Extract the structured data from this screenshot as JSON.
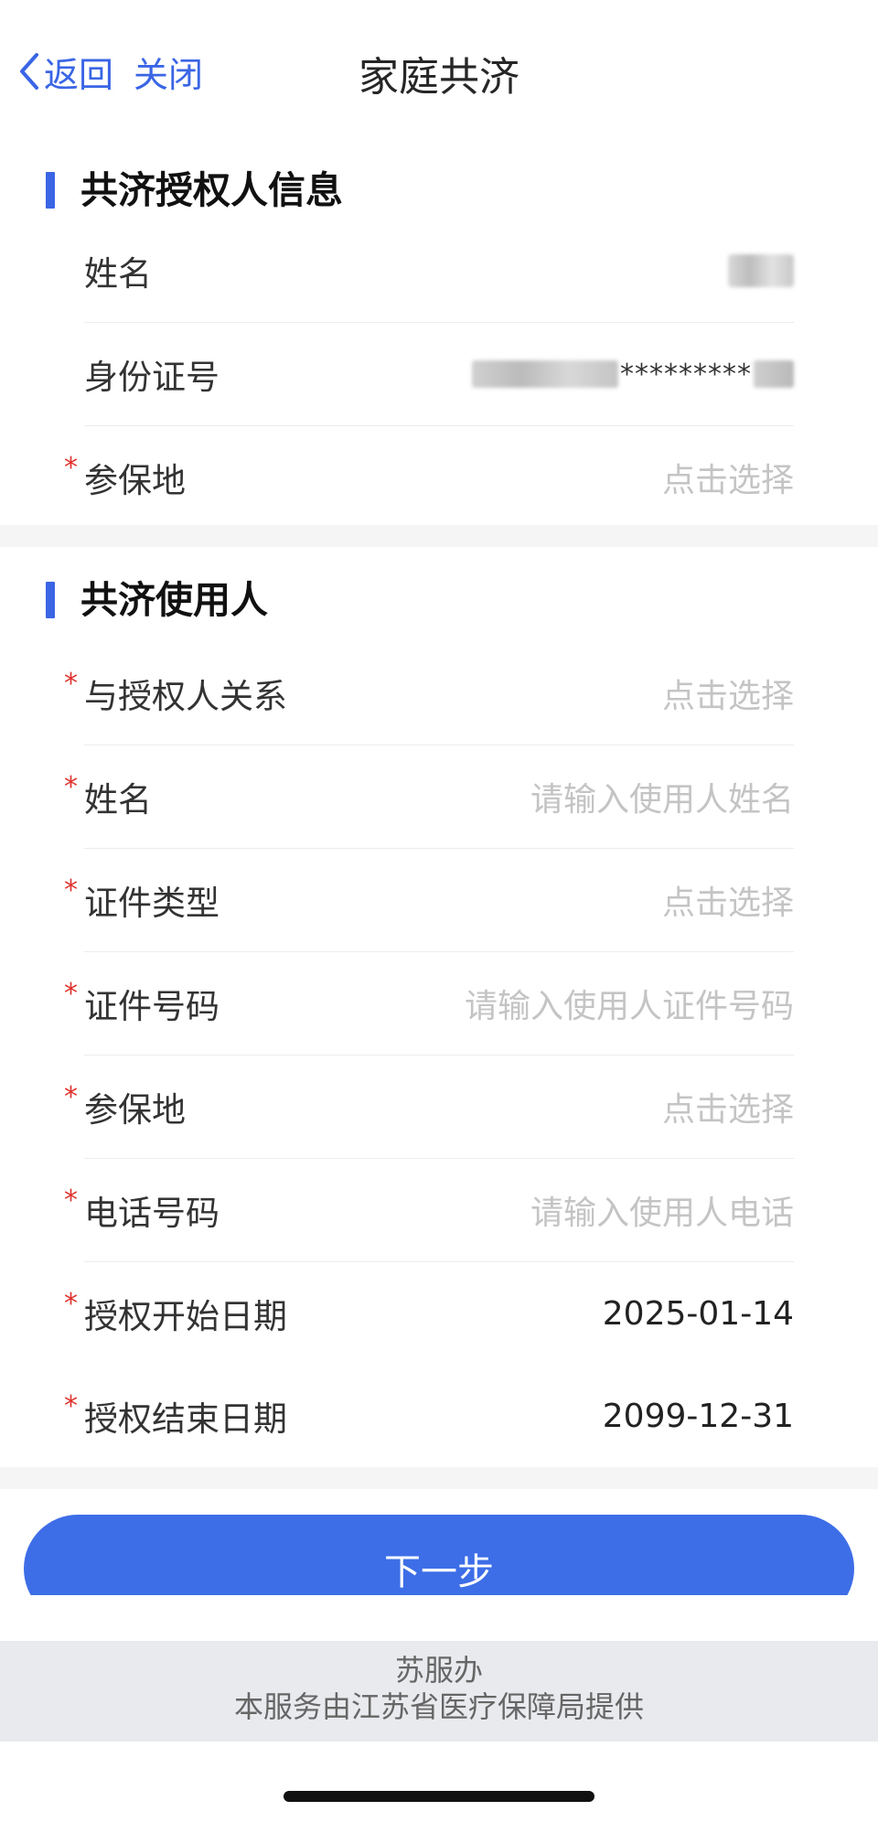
{
  "nav": {
    "back_label": "返回",
    "close_label": "关闭",
    "title": "家庭共济"
  },
  "authorizer": {
    "section_title": "共济授权人信息",
    "rows": [
      {
        "label": "姓名",
        "required": false,
        "value_masked": true
      },
      {
        "label": "身份证号",
        "required": false,
        "value_partial": "*********"
      },
      {
        "label": "参保地",
        "required": true,
        "placeholder": "点击选择"
      }
    ]
  },
  "user": {
    "section_title": "共济使用人",
    "rows": [
      {
        "label": "与授权人关系",
        "placeholder": "点击选择"
      },
      {
        "label": "姓名",
        "placeholder": "请输入使用人姓名"
      },
      {
        "label": "证件类型",
        "placeholder": "点击选择"
      },
      {
        "label": "证件号码",
        "placeholder": "请输入使用人证件号码"
      },
      {
        "label": "参保地",
        "placeholder": "点击选择"
      },
      {
        "label": "电话号码",
        "placeholder": "请输入使用人电话"
      },
      {
        "label": "授权开始日期",
        "value": "2025-01-14"
      },
      {
        "label": "授权结束日期",
        "value": "2099-12-31"
      }
    ],
    "required_mark": "*"
  },
  "next_button": "下一步",
  "footer": {
    "line1": "苏服办",
    "line2": "本服务由江苏省医疗保障局提供"
  },
  "colors": {
    "accent": "#3a66e6",
    "button": "#3d6ee8",
    "required": "#e0322d",
    "placeholder": "#c4c4c4",
    "footer_bg": "#e9eaed"
  }
}
